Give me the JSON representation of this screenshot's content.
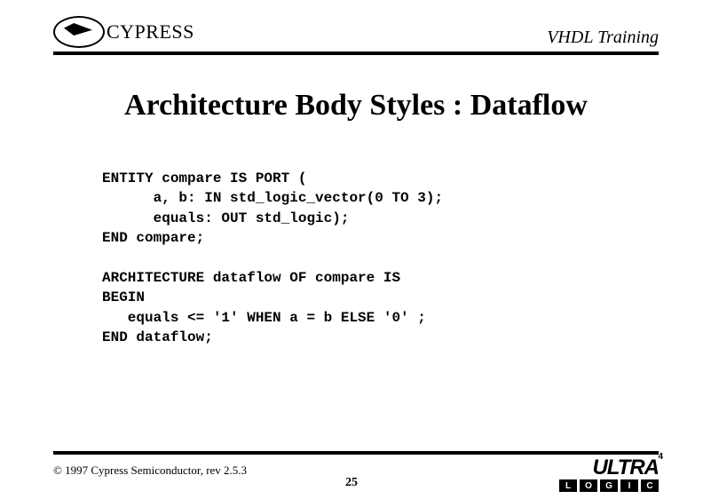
{
  "header": {
    "brand": "CYPRESS",
    "title": "VHDL Training"
  },
  "slide_title": "Architecture Body Styles : Dataflow",
  "code": "ENTITY compare IS PORT (\n      a, b: IN std_logic_vector(0 TO 3);\n      equals: OUT std_logic);\nEND compare;\n\nARCHITECTURE dataflow OF compare IS\nBEGIN\n   equals <= '1' WHEN a = b ELSE '0' ;\nEND dataflow;",
  "footer": {
    "copyright": "© 1997 Cypress Semiconductor, rev 2.5.3",
    "page": "25",
    "ultra_text": "ULTRA",
    "ultra_letters": [
      "L",
      "O",
      "G",
      "I",
      "C"
    ],
    "ultra_num": "4"
  }
}
